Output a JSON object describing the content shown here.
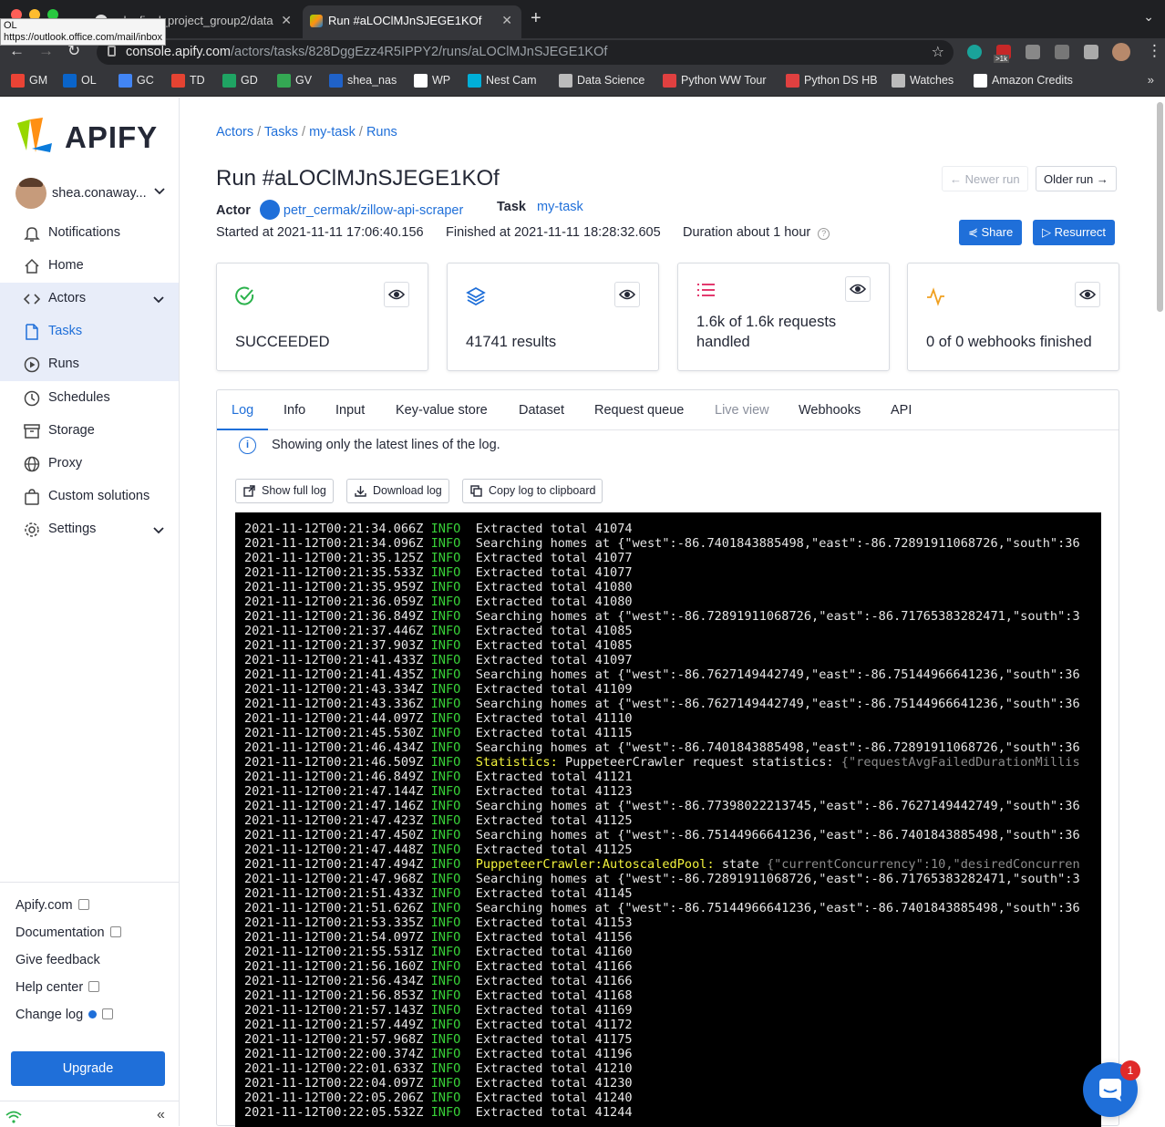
{
  "browser": {
    "tabs": [
      {
        "label": "eda_final_project_group2/data"
      },
      {
        "label": "Run #aLOClMJnSJEGE1KOf"
      }
    ],
    "tooltip_lines": [
      "OL",
      "https://outlook.office.com/mail/inbox"
    ],
    "url_host": "console.apify.com",
    "url_path": "/actors/tasks/828DggEzz4R5IPPY2/runs/aLOClMJnSJEGE1KOf",
    "ext_badge": ">1k",
    "bookmarks": [
      {
        "label": "GM",
        "color": "#ea4335"
      },
      {
        "label": "OL",
        "color": "#0a64c9"
      },
      {
        "label": "GC",
        "color": "#4285f4"
      },
      {
        "label": "TD",
        "color": "#e44332"
      },
      {
        "label": "GD",
        "color": "#1fa463"
      },
      {
        "label": "GV",
        "color": "#34a853"
      },
      {
        "label": "shea_nas",
        "color": "#2062c8"
      },
      {
        "label": "WP",
        "color": "#ffffff"
      },
      {
        "label": "Nest Cam",
        "color": "#00afd8"
      },
      {
        "label": "Data Science",
        "color": "#bbbbbb"
      },
      {
        "label": "Python WW Tour",
        "color": "#e04040"
      },
      {
        "label": "Python DS HB",
        "color": "#e04040"
      },
      {
        "label": "Watches",
        "color": "#bbbbbb"
      },
      {
        "label": "Amazon Credits",
        "color": "#ffffff"
      }
    ]
  },
  "sidebar": {
    "logo": "APIFY",
    "user_name": "shea.conaway...",
    "items": [
      {
        "label": "Notifications",
        "icon": "bell-icon"
      },
      {
        "label": "Home",
        "icon": "home-icon"
      },
      {
        "label": "Actors",
        "icon": "code-icon"
      },
      {
        "label": "Tasks",
        "icon": "file-icon"
      },
      {
        "label": "Runs",
        "icon": "play-icon"
      },
      {
        "label": "Schedules",
        "icon": "clock-icon"
      },
      {
        "label": "Storage",
        "icon": "archive-icon"
      },
      {
        "label": "Proxy",
        "icon": "globe-icon"
      },
      {
        "label": "Custom solutions",
        "icon": "bag-icon"
      },
      {
        "label": "Settings",
        "icon": "gear-icon"
      }
    ],
    "footer": {
      "apify_com": "Apify.com",
      "documentation": "Documentation",
      "feedback": "Give feedback",
      "help": "Help center",
      "changelog": "Change log"
    },
    "upgrade": "Upgrade"
  },
  "main": {
    "breadcrumb": [
      "Actors",
      "Tasks",
      "my-task",
      "Runs"
    ],
    "title": "Run #aLOClMJnSJEGE1KOf",
    "actor_label": "Actor",
    "actor_value": "petr_cermak/zillow-api-scraper",
    "task_label": "Task",
    "task_value": "my-task",
    "started": "Started at 2021-11-11 17:06:40.156",
    "finished": "Finished at 2021-11-11 18:28:32.605",
    "duration": "Duration about 1 hour",
    "newer_run": "Newer run",
    "older_run": "Older run",
    "share": "Share",
    "resurrect": "Resurrect",
    "cards": [
      {
        "text": "SUCCEEDED",
        "icon": "check-circle-icon",
        "color": "#2bb24c"
      },
      {
        "text": "41741 results",
        "icon": "layers-icon",
        "color": "#1f6fd9"
      },
      {
        "text": "1.6k of 1.6k requests handled",
        "icon": "list-icon",
        "color": "#e0245e"
      },
      {
        "text": "0 of 0 webhooks finished",
        "icon": "activity-icon",
        "color": "#f0a020"
      }
    ],
    "tabs": [
      "Log",
      "Info",
      "Input",
      "Key-value store",
      "Dataset",
      "Request queue",
      "Live view",
      "Webhooks",
      "API"
    ],
    "info_text": "Showing only the latest lines of the log.",
    "show_full_log": "Show full log",
    "download_log": "Download log",
    "copy_log": "Copy log to clipboard",
    "log_lines": [
      {
        "ts": "2021-11-12T00:21:34.066Z",
        "lv": "INFO",
        "msg": "Extracted total 41074"
      },
      {
        "ts": "2021-11-12T00:21:34.096Z",
        "lv": "INFO",
        "msg": "Searching homes at {\"west\":-86.7401843885498,\"east\":-86.72891911068726,\"south\":36"
      },
      {
        "ts": "2021-11-12T00:21:35.125Z",
        "lv": "INFO",
        "msg": "Extracted total 41077"
      },
      {
        "ts": "2021-11-12T00:21:35.533Z",
        "lv": "INFO",
        "msg": "Extracted total 41077"
      },
      {
        "ts": "2021-11-12T00:21:35.959Z",
        "lv": "INFO",
        "msg": "Extracted total 41080"
      },
      {
        "ts": "2021-11-12T00:21:36.059Z",
        "lv": "INFO",
        "msg": "Extracted total 41080"
      },
      {
        "ts": "2021-11-12T00:21:36.849Z",
        "lv": "INFO",
        "msg": "Searching homes at {\"west\":-86.72891911068726,\"east\":-86.71765383282471,\"south\":3"
      },
      {
        "ts": "2021-11-12T00:21:37.446Z",
        "lv": "INFO",
        "msg": "Extracted total 41085"
      },
      {
        "ts": "2021-11-12T00:21:37.903Z",
        "lv": "INFO",
        "msg": "Extracted total 41085"
      },
      {
        "ts": "2021-11-12T00:21:41.433Z",
        "lv": "INFO",
        "msg": "Extracted total 41097"
      },
      {
        "ts": "2021-11-12T00:21:41.435Z",
        "lv": "INFO",
        "msg": "Searching homes at {\"west\":-86.7627149442749,\"east\":-86.75144966641236,\"south\":36"
      },
      {
        "ts": "2021-11-12T00:21:43.334Z",
        "lv": "INFO",
        "msg": "Extracted total 41109"
      },
      {
        "ts": "2021-11-12T00:21:43.336Z",
        "lv": "INFO",
        "msg": "Searching homes at {\"west\":-86.7627149442749,\"east\":-86.75144966641236,\"south\":36"
      },
      {
        "ts": "2021-11-12T00:21:44.097Z",
        "lv": "INFO",
        "msg": "Extracted total 41110"
      },
      {
        "ts": "2021-11-12T00:21:45.530Z",
        "lv": "INFO",
        "msg": "Extracted total 41115"
      },
      {
        "ts": "2021-11-12T00:21:46.434Z",
        "lv": "INFO",
        "msg": "Searching homes at {\"west\":-86.7401843885498,\"east\":-86.72891911068726,\"south\":36"
      },
      {
        "ts": "2021-11-12T00:21:46.509Z",
        "lv": "INFO",
        "hl": "Statistics:",
        "msg": " PuppeteerCrawler request statistics: ",
        "dim": "{\"requestAvgFailedDurationMillis"
      },
      {
        "ts": "2021-11-12T00:21:46.849Z",
        "lv": "INFO",
        "msg": "Extracted total 41121"
      },
      {
        "ts": "2021-11-12T00:21:47.144Z",
        "lv": "INFO",
        "msg": "Extracted total 41123"
      },
      {
        "ts": "2021-11-12T00:21:47.146Z",
        "lv": "INFO",
        "msg": "Searching homes at {\"west\":-86.77398022213745,\"east\":-86.7627149442749,\"south\":36"
      },
      {
        "ts": "2021-11-12T00:21:47.423Z",
        "lv": "INFO",
        "msg": "Extracted total 41125"
      },
      {
        "ts": "2021-11-12T00:21:47.450Z",
        "lv": "INFO",
        "msg": "Searching homes at {\"west\":-86.75144966641236,\"east\":-86.7401843885498,\"south\":36"
      },
      {
        "ts": "2021-11-12T00:21:47.448Z",
        "lv": "INFO",
        "msg": "Extracted total 41125"
      },
      {
        "ts": "2021-11-12T00:21:47.494Z",
        "lv": "INFO",
        "hl": "PuppeteerCrawler:AutoscaledPool:",
        "msg": " state ",
        "dim": "{\"currentConcurrency\":10,\"desiredConcurren"
      },
      {
        "ts": "2021-11-12T00:21:47.968Z",
        "lv": "INFO",
        "msg": "Searching homes at {\"west\":-86.72891911068726,\"east\":-86.71765383282471,\"south\":3"
      },
      {
        "ts": "2021-11-12T00:21:51.433Z",
        "lv": "INFO",
        "msg": "Extracted total 41145"
      },
      {
        "ts": "2021-11-12T00:21:51.626Z",
        "lv": "INFO",
        "msg": "Searching homes at {\"west\":-86.75144966641236,\"east\":-86.7401843885498,\"south\":36"
      },
      {
        "ts": "2021-11-12T00:21:53.335Z",
        "lv": "INFO",
        "msg": "Extracted total 41153"
      },
      {
        "ts": "2021-11-12T00:21:54.097Z",
        "lv": "INFO",
        "msg": "Extracted total 41156"
      },
      {
        "ts": "2021-11-12T00:21:55.531Z",
        "lv": "INFO",
        "msg": "Extracted total 41160"
      },
      {
        "ts": "2021-11-12T00:21:56.160Z",
        "lv": "INFO",
        "msg": "Extracted total 41166"
      },
      {
        "ts": "2021-11-12T00:21:56.434Z",
        "lv": "INFO",
        "msg": "Extracted total 41166"
      },
      {
        "ts": "2021-11-12T00:21:56.853Z",
        "lv": "INFO",
        "msg": "Extracted total 41168"
      },
      {
        "ts": "2021-11-12T00:21:57.143Z",
        "lv": "INFO",
        "msg": "Extracted total 41169"
      },
      {
        "ts": "2021-11-12T00:21:57.449Z",
        "lv": "INFO",
        "msg": "Extracted total 41172"
      },
      {
        "ts": "2021-11-12T00:21:57.968Z",
        "lv": "INFO",
        "msg": "Extracted total 41175"
      },
      {
        "ts": "2021-11-12T00:22:00.374Z",
        "lv": "INFO",
        "msg": "Extracted total 41196"
      },
      {
        "ts": "2021-11-12T00:22:01.633Z",
        "lv": "INFO",
        "msg": "Extracted total 41210"
      },
      {
        "ts": "2021-11-12T00:22:04.097Z",
        "lv": "INFO",
        "msg": "Extracted total 41230"
      },
      {
        "ts": "2021-11-12T00:22:05.206Z",
        "lv": "INFO",
        "msg": "Extracted total 41240"
      },
      {
        "ts": "2021-11-12T00:22:05.532Z",
        "lv": "INFO",
        "msg": "Extracted total 41244"
      }
    ]
  },
  "chat_badge": "1"
}
